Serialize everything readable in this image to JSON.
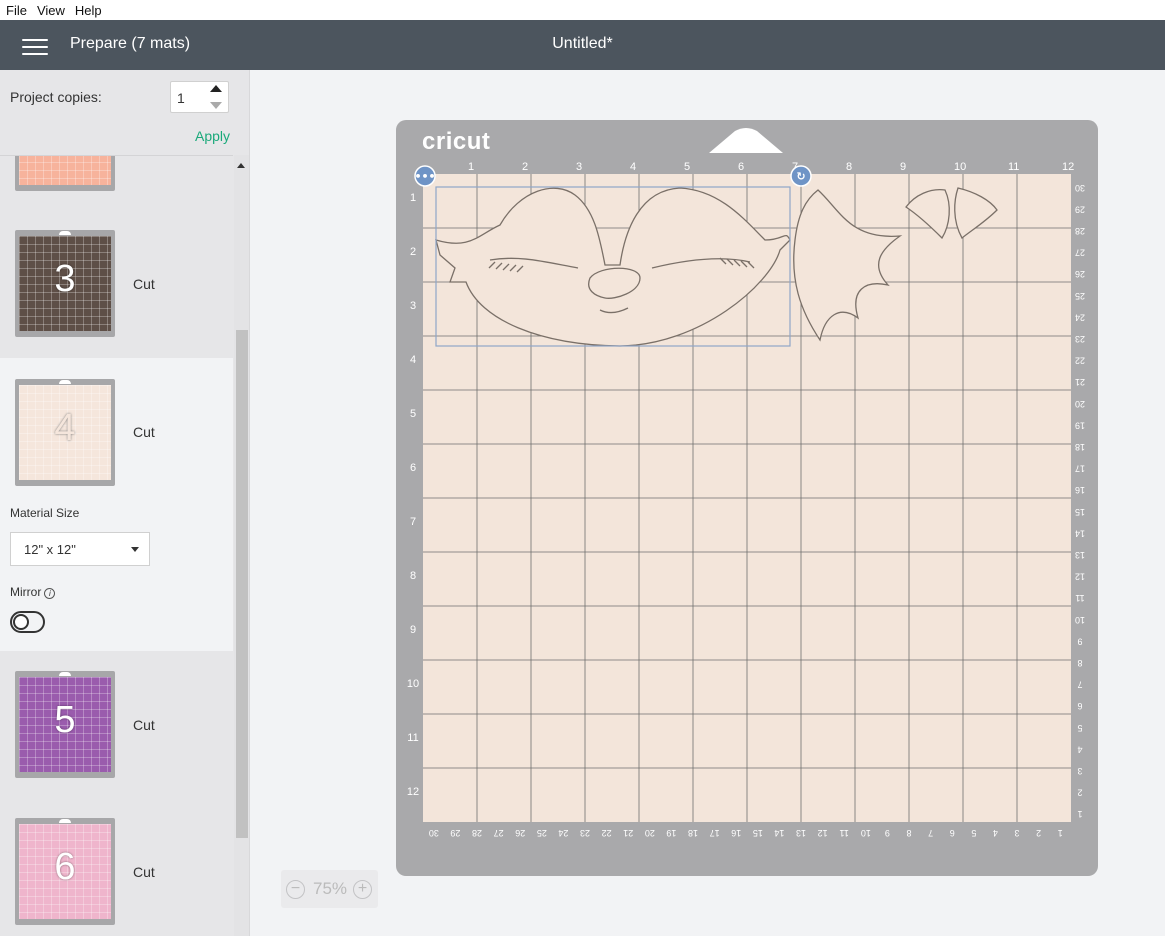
{
  "menubar": {
    "items": [
      "File",
      "View",
      "Help"
    ]
  },
  "header": {
    "title": "Prepare (7 mats)",
    "document_title": "Untitled*"
  },
  "project": {
    "copies_label": "Project copies:",
    "copies_value": "1",
    "apply_label": "Apply"
  },
  "mats": [
    {
      "number": "",
      "action": "",
      "color": "#f7b39c",
      "partial": true
    },
    {
      "number": "3",
      "action": "Cut",
      "color": "#5e4f47"
    },
    {
      "number": "4",
      "action": "Cut",
      "color": "#f5e6dc",
      "selected": true
    },
    {
      "number": "5",
      "action": "Cut",
      "color": "#9a5cad"
    },
    {
      "number": "6",
      "action": "Cut",
      "color": "#efb5cc"
    }
  ],
  "material_size": {
    "label": "Material Size",
    "value": "12\" x 12\""
  },
  "mirror": {
    "label": "Mirror",
    "on": false
  },
  "mat_view": {
    "brand": "cricut",
    "mat_color": "#f3e5da",
    "top_ruler": [
      "1",
      "2",
      "3",
      "4",
      "5",
      "6",
      "7",
      "8",
      "9",
      "10",
      "11",
      "12"
    ],
    "left_ruler": [
      "1",
      "2",
      "3",
      "4",
      "5",
      "6",
      "7",
      "8",
      "9",
      "10",
      "11",
      "12"
    ],
    "right_ruler": [
      "30",
      "29",
      "28",
      "27",
      "26",
      "25",
      "24",
      "23",
      "22",
      "21",
      "20",
      "19",
      "18",
      "17",
      "16",
      "15",
      "14",
      "13",
      "12",
      "11",
      "10",
      "9",
      "8",
      "7",
      "6",
      "5",
      "4",
      "3",
      "2",
      "1"
    ],
    "bottom_ruler": [
      "30",
      "29",
      "28",
      "27",
      "26",
      "25",
      "24",
      "23",
      "22",
      "21",
      "20",
      "19",
      "18",
      "17",
      "16",
      "15",
      "14",
      "13",
      "12",
      "11",
      "10",
      "9",
      "8",
      "7",
      "6",
      "5",
      "4",
      "3",
      "2",
      "1"
    ]
  },
  "zoom": {
    "value": "75%",
    "minus": "−",
    "plus": "+"
  },
  "icons": {
    "menu": "hamburger-icon",
    "more": "more-options-icon",
    "rotate": "rotate-icon",
    "info": "info-icon"
  }
}
